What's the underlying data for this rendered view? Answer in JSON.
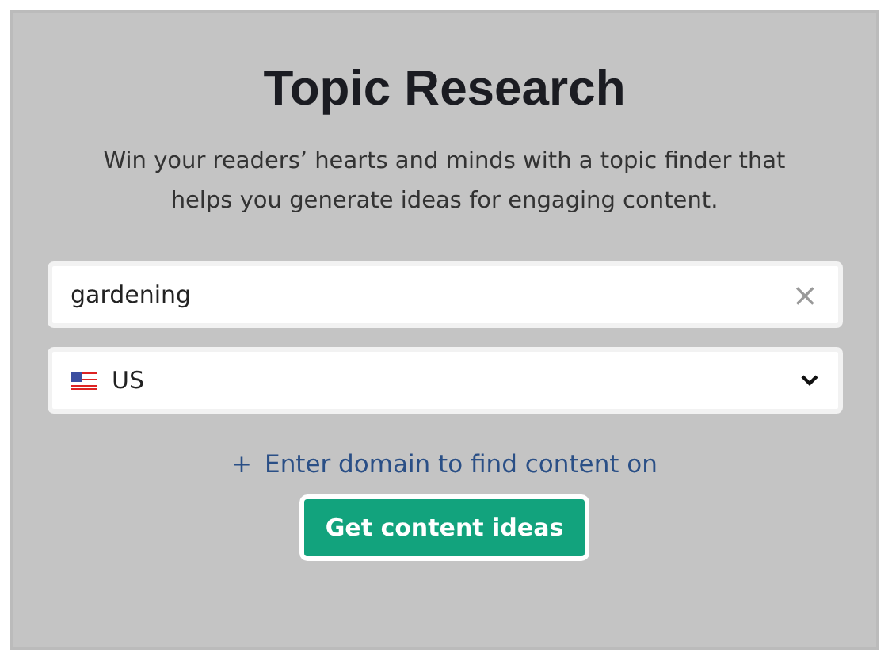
{
  "title": "Topic Research",
  "description": "Win your readers’ hearts and minds with a topic finder that helps you generate ideas for engaging content.",
  "search": {
    "value": "gardening",
    "clear_icon": "×"
  },
  "country": {
    "value": "US"
  },
  "domain_link": {
    "icon": "+",
    "label": "Enter domain to find content on"
  },
  "submit_button": "Get content ideas"
}
